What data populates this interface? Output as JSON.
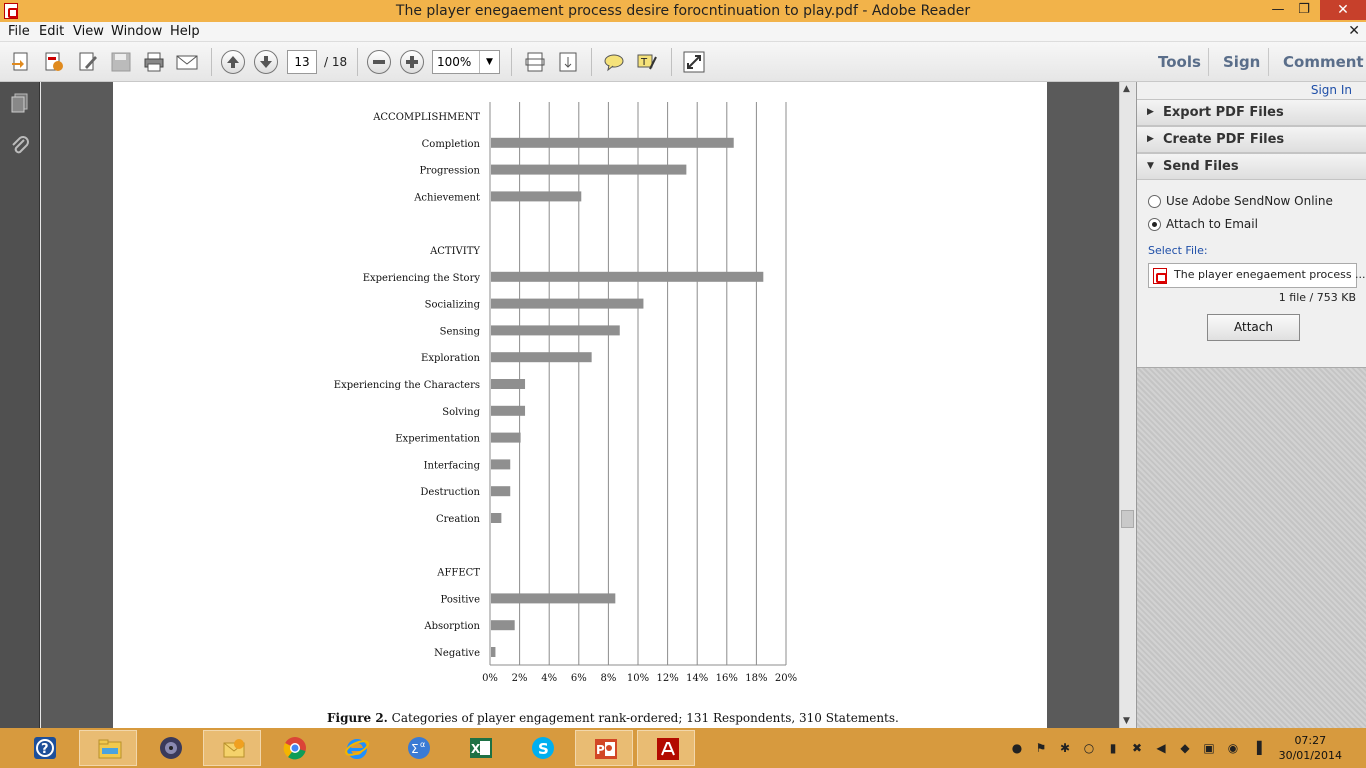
{
  "window": {
    "title": "The player enegaement process desire forocntinuation to play.pdf - Adobe Reader",
    "min_glyph": "—",
    "max_glyph": "❐",
    "close_glyph": "✕"
  },
  "menu": {
    "items": [
      "File",
      "Edit",
      "View",
      "Window",
      "Help"
    ],
    "close_doc_glyph": "✕"
  },
  "toolbar": {
    "page_current": "13",
    "page_total": "/ 18",
    "zoom": "100%",
    "zoom_dropdown_glyph": "▼",
    "tabs": [
      "Tools",
      "Sign",
      "Comment"
    ]
  },
  "chart_data": {
    "type": "bar",
    "orientation": "horizontal",
    "groups": [
      {
        "name": "ACCOMPLISHMENT",
        "categories": [
          "Completion",
          "Progression",
          "Achievement"
        ],
        "values": [
          16.4,
          13.2,
          6.1
        ]
      },
      {
        "name": "ACTIVITY",
        "categories": [
          "Experiencing the Story",
          "Socializing",
          "Sensing",
          "Exploration",
          "Experiencing the Characters",
          "Solving",
          "Experimentation",
          "Interfacing",
          "Destruction",
          "Creation"
        ],
        "values": [
          18.4,
          10.3,
          8.7,
          6.8,
          2.3,
          2.3,
          2.0,
          1.3,
          1.3,
          0.7
        ]
      },
      {
        "name": "AFFECT",
        "categories": [
          "Positive",
          "Absorption",
          "Negative"
        ],
        "values": [
          8.4,
          1.6,
          0.3
        ]
      }
    ],
    "xlim": [
      0,
      20
    ],
    "x_ticks": [
      "0%",
      "2%",
      "4%",
      "6%",
      "8%",
      "10%",
      "12%",
      "14%",
      "16%",
      "18%",
      "20%"
    ],
    "grid": true,
    "caption_bold": "Figure 2.",
    "caption_text": " Categories of player engagement rank-ordered; 131 Respondents, 310 Statements."
  },
  "rightpanel": {
    "sign_in": "Sign In",
    "sections": [
      "Export PDF Files",
      "Create PDF Files",
      "Send Files"
    ],
    "collapsed_arrow": "▶",
    "expanded_arrow": "▼",
    "options": [
      "Use Adobe SendNow Online",
      "Attach to Email"
    ],
    "selected_option": "Attach to Email",
    "select_file_label": "Select File:",
    "file_name": "The player enegaement process ...",
    "file_info": "1 file / 753 KB",
    "attach_button": "Attach"
  },
  "taskbar": {
    "apps": [
      "help",
      "file-explorer",
      "media-player",
      "outlook",
      "chrome",
      "internet-explorer",
      "calculator",
      "excel",
      "skype",
      "powerpoint",
      "adobe-reader"
    ],
    "clock_time": "07:27",
    "clock_date": "30/01/2014"
  }
}
